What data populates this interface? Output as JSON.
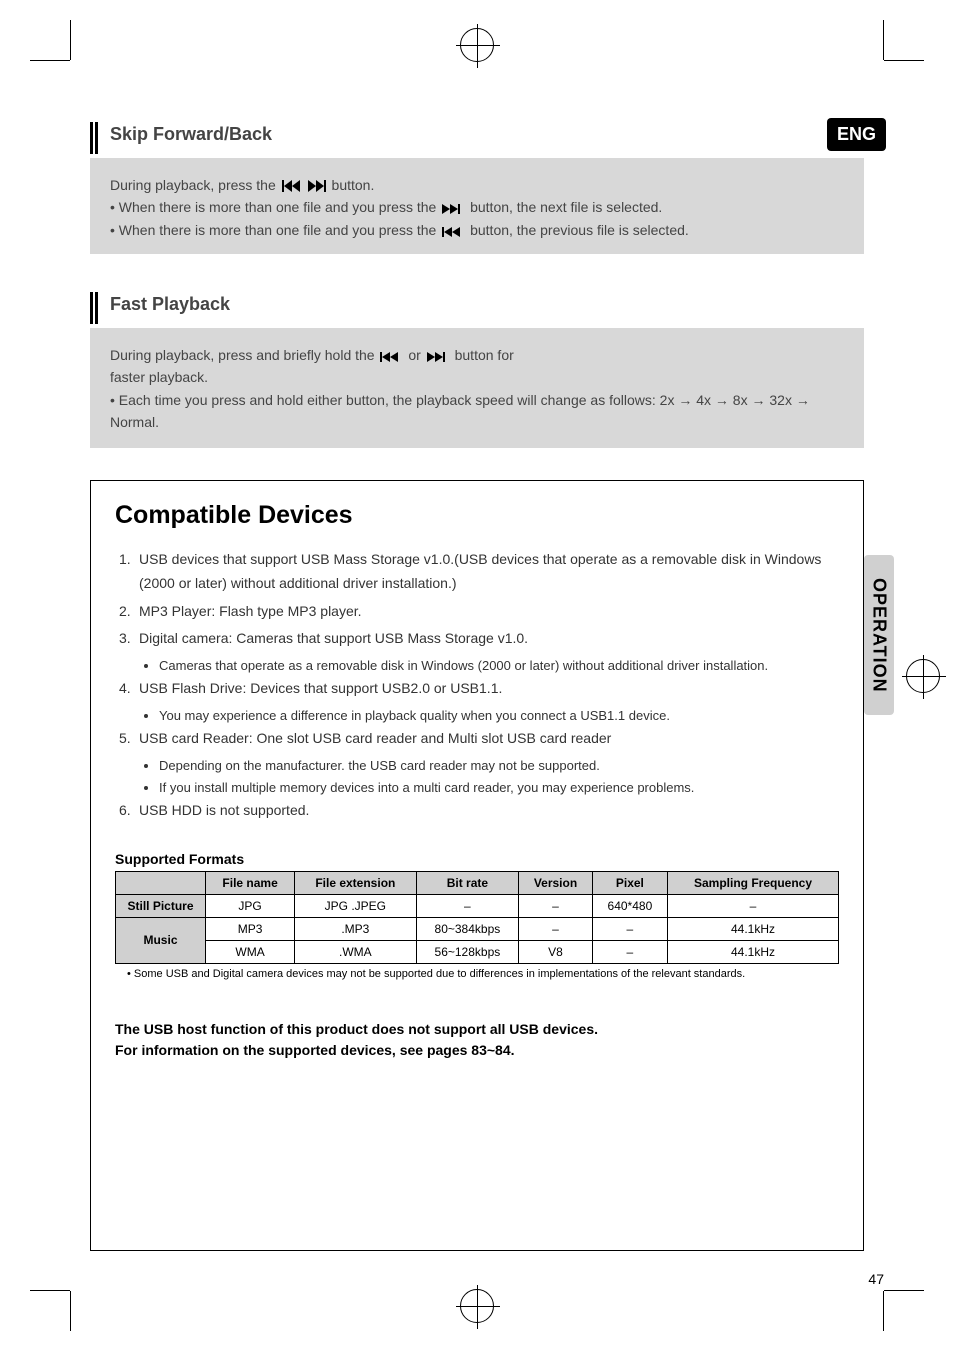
{
  "badge": "ENG",
  "side_tab": "OPERATION",
  "page_number": "47",
  "section1": {
    "heading": "Skip Forward/Back",
    "line1_a": "During playback, press the",
    "line1_b": "button.",
    "bullet1_a": "When there is more than one file and you press the",
    "bullet1_b": "button, the next file is selected.",
    "bullet2_a": "When there is more than one file and you press the",
    "bullet2_b": "button, the previous file is selected."
  },
  "section2": {
    "heading": "Fast Playback",
    "line1_a": "During playback, press and briefly hold the",
    "line1_b": "or",
    "line1_c": "button for",
    "line2": "faster playback.",
    "bullet1": "Each time you press and hold either button, the playback speed will change as follows: 2x → 4x → 8x → 32x → Normal."
  },
  "box": {
    "title": "Compatible Devices",
    "items_pre": [
      "USB devices that support USB Mass Storage v1.0.(USB devices that operate as a removable disk in Windows (2000 or later) without additional driver installation.)",
      "MP3 Player: Flash type MP3 player.",
      "Digital camera: Cameras that support USB Mass Storage v1.0."
    ],
    "item3_sub": "Cameras that operate as a removable disk in Windows (2000 or later) without additional driver installation.",
    "items_post": [
      "USB Flash Drive: Devices that support USB2.0 or USB1.1.",
      "USB card Reader: One slot USB card reader and Multi slot USB card reader",
      "USB HDD is not supported."
    ],
    "item4_sub": "You may experience a difference in playback quality when you connect a USB1.1 device.",
    "item5_sub1": "Depending on the manufacturer. the USB card reader may not be supported.",
    "item5_sub2": "If you install multiple memory devices into a multi card reader, you may experience problems."
  },
  "table": {
    "heading": "Supported Formats",
    "headers": [
      "",
      "File name",
      "File extension",
      "Bit rate",
      "Version",
      "Pixel",
      "Sampling Frequency"
    ],
    "rows": [
      {
        "head": "Still Picture",
        "cells": [
          "JPG",
          "JPG .JPEG",
          "–",
          "–",
          "640*480",
          "–"
        ]
      },
      {
        "head_span": "Music",
        "cells": [
          "MP3",
          ".MP3",
          "80~384kbps",
          "–",
          "–",
          "44.1kHz"
        ]
      },
      {
        "cells": [
          "WMA",
          ".WMA",
          "56~128kbps",
          "V8",
          "–",
          "44.1kHz"
        ]
      }
    ],
    "note": "Some USB and Digital camera devices may not be supported due to differences in implementations of the relevant standards."
  },
  "footer": {
    "line1": "The USB host function of this product does not support all USB devices.",
    "line2": "For information on the supported devices, see pages 83~84."
  },
  "icons": {
    "prev_next": "prev-next",
    "next": "next",
    "prev": "prev"
  }
}
